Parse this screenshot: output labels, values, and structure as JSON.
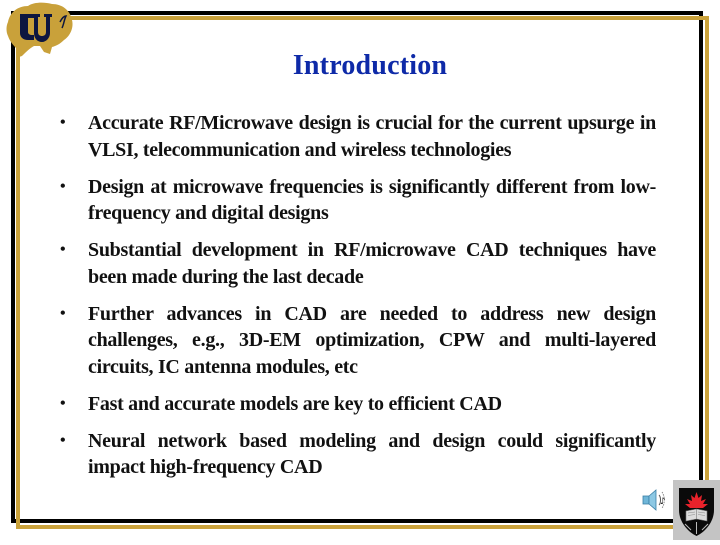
{
  "slide": {
    "title": "Introduction",
    "title_color": "#0e2aa8",
    "bullet_glyph": "•",
    "bullets": [
      "Accurate RF/Microwave design is crucial for the current upsurge in VLSI, telecommunication and wireless technologies",
      "Design at microwave frequencies is significantly different from low-frequency and digital designs",
      "Substantial development in RF/microwave CAD techniques have been made during the last decade",
      "Further advances in CAD are needed to address new design challenges, e.g., 3D-EM optimization, CPW and multi-layered circuits, IC antenna modules, etc",
      "Fast and accurate models are key to efficient CAD",
      "Neural network based modeling and design could significantly impact high-frequency CAD"
    ]
  },
  "icons": {
    "top_left_logo": "cu-buffalo-logo",
    "bottom_right_logo": "university-crest-logo",
    "audio": "speaker-icon"
  },
  "colors": {
    "frame_black": "#000000",
    "frame_gold": "#c9a13a",
    "logo_gold": "#c9a13a",
    "logo_navy": "#0d1640",
    "crest_red": "#e8222b"
  }
}
